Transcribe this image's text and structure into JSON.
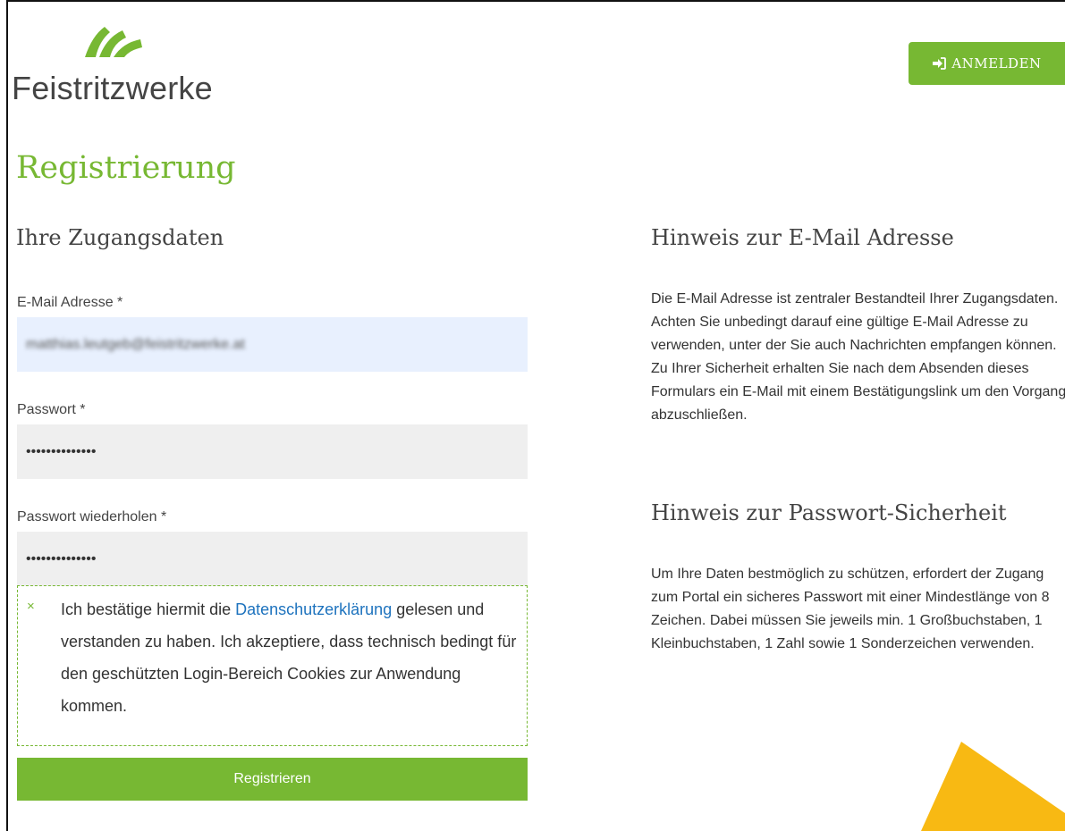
{
  "brand": {
    "name": "Feistritzwerke",
    "green": "#77b833",
    "accent_yellow": "#f8b913"
  },
  "header": {
    "login_label": "ANMELDEN",
    "login_icon": "sign-in-icon"
  },
  "page": {
    "title": "Registrierung"
  },
  "form": {
    "section_title": "Ihre Zugangsdaten",
    "email": {
      "label": "E-Mail Adresse *",
      "value": "matthias.leutgeb@feistritzwerke.at"
    },
    "password": {
      "label": "Passwort *",
      "value": "••••••••••••••"
    },
    "password_repeat": {
      "label": "Passwort wiederholen *",
      "value": "••••••••••••••"
    },
    "consent": {
      "checkmark": "×",
      "text_before": "Ich bestätige hiermit die ",
      "link": "Datenschutzerklärung",
      "text_after": " gelesen und verstanden zu haben. Ich akzeptiere, dass technisch bedingt für den geschützten Login-Bereich Cookies zur Anwendung kommen."
    },
    "submit_label": "Registrieren"
  },
  "info": {
    "email_title": "Hinweis zur E-Mail Adresse",
    "email_text_1": "Die E-Mail Adresse ist zentraler Bestandteil Ihrer Zugangsdaten. Achten Sie unbedingt darauf eine gültige E-Mail Adresse zu verwenden, unter der Sie auch Nachrichten empfangen können.",
    "email_text_2": "Zu Ihrer Sicherheit erhalten Sie nach dem Absenden dieses Formulars ein E-Mail mit einem Bestätigungslink um den Vorgang abzuschließen.",
    "pw_title": "Hinweis zur Passwort-Sicherheit",
    "pw_text": "Um Ihre Daten bestmöglich zu schützen, erfordert der Zugang zum Portal ein sicheres Passwort mit einer Mindestlänge von 8 Zeichen. Dabei müssen Sie jeweils min. 1 Großbuchstaben, 1 Kleinbuchstaben, 1 Zahl sowie 1 Sonderzeichen verwenden."
  }
}
